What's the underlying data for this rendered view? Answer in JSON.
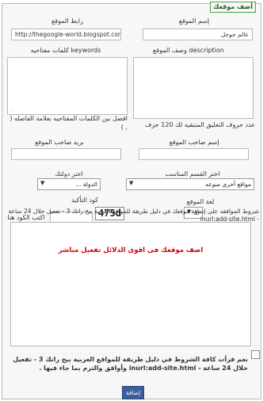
{
  "form": {
    "legend": "أضف موقعك",
    "site_name": {
      "label": "إسم الموقع",
      "value": "عالم جوجل"
    },
    "site_url": {
      "label": "رابط الموقع",
      "value": "http://thegoogle-world.blogspot.com/"
    },
    "description": {
      "label": "وصف الموقع description",
      "note": "عدد حروف التعليق المتبقيه لك 120 حرف"
    },
    "keywords": {
      "label": "كلمات مفتاحيه keywords",
      "note": "افصل بين الكلمات المفتاحيه بعلامة الفاصله ( , )"
    },
    "owner_name": {
      "label": "إسم صاحب الموقع",
      "value": ""
    },
    "owner_email": {
      "label": "بريد صاحب الموقع",
      "value": ""
    },
    "category": {
      "label": "اختر القسم المناسب",
      "selected": "مواقع أخرى منوعه"
    },
    "country": {
      "label": "اختر دولتك",
      "selected": "الدولة ..."
    },
    "language": {
      "label": "لغة الموقع",
      "selected": "ar"
    },
    "captcha": {
      "label": "كود التأكيد",
      "code": "475d",
      "input_label": "اكتب الكود هنا"
    },
    "conditions_label": "شروط الموافقه على إضافة موقعك في دليل طريقة للمواقع العربية بيج رانك 3 - تفعيل خلال 24 ساعة - inurl:add-site.html",
    "conditions_text": "اضف موقعك فى اقوى الدلائل تفعيل مباشر",
    "agree_text": "نعم قرأت كافة الشروط في دليل طريقة للمواقع العربية بيج رانك 3 - تفعيل خلال 24 ساعة - inurl:add-site.html وأوافق والتزم بما جاء فيها .",
    "submit_label": "إضافة"
  }
}
